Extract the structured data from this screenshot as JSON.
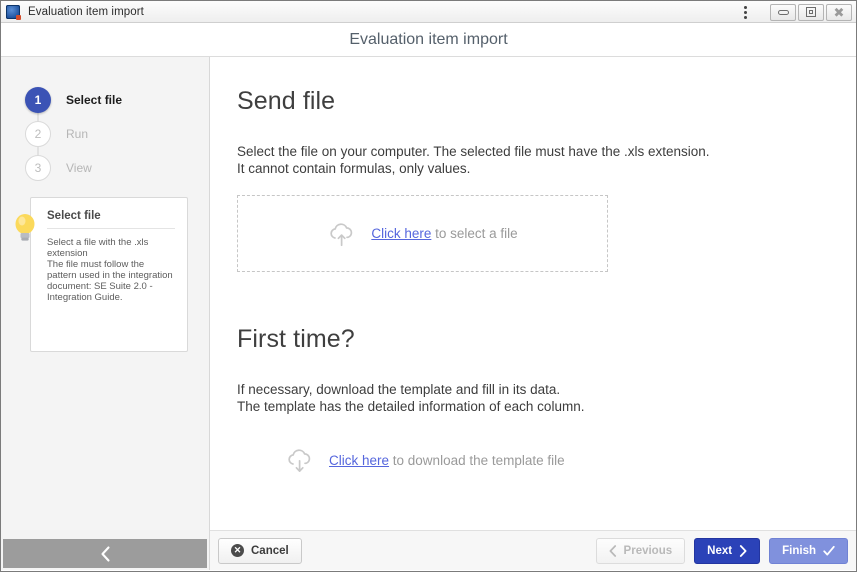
{
  "titlebar": {
    "app_icon": "se-suite-icon",
    "title": "Evaluation item import",
    "menu_icon": "kebab-menu-icon",
    "minimize_icon": "minimize-icon",
    "maximize_icon": "maximize-icon",
    "close_icon": "close-icon"
  },
  "dialog": {
    "title": "Evaluation item import"
  },
  "sidebar": {
    "steps": [
      {
        "number": "1",
        "label": "Select file",
        "state": "active"
      },
      {
        "number": "2",
        "label": "Run",
        "state": "idle"
      },
      {
        "number": "3",
        "label": "View",
        "state": "idle"
      }
    ],
    "tip": {
      "icon": "lightbulb-icon",
      "title": "Select file",
      "text": "Select a file with the .xls extension\nThe file must follow the pattern used in the integration document: SE Suite 2.0 - Integration Guide."
    },
    "collapse": {
      "icon": "chevron-left-icon"
    }
  },
  "main": {
    "section_send": {
      "heading": "Send file",
      "description": "Select the file on your computer. The selected file must have the .xls extension.\nIt cannot contain formulas, only values.",
      "dropzone": {
        "icon": "cloud-upload-icon",
        "link_text": "Click here",
        "rest_text": " to select a file"
      }
    },
    "section_first_time": {
      "heading": "First time?",
      "description": "If necessary, download the template and fill in its data.\nThe template has the detailed information of each column.",
      "download": {
        "icon": "cloud-download-icon",
        "link_text": "Click here",
        "rest_text": " to download the template file"
      }
    }
  },
  "footer": {
    "cancel_label": "Cancel",
    "cancel_icon": "cancel-circle-icon",
    "previous_label": "Previous",
    "previous_icon": "chevron-left-icon",
    "next_label": "Next",
    "next_icon": "chevron-right-icon",
    "finish_label": "Finish",
    "finish_icon": "check-icon"
  },
  "colors": {
    "accent_blue": "#2b42b8",
    "step_active": "#3b53b5",
    "finish_blue": "#8091dd",
    "link_blue": "#5566dd",
    "sidebar_bg": "#f4f4f4",
    "collapse_bar": "#9c9c9c"
  }
}
